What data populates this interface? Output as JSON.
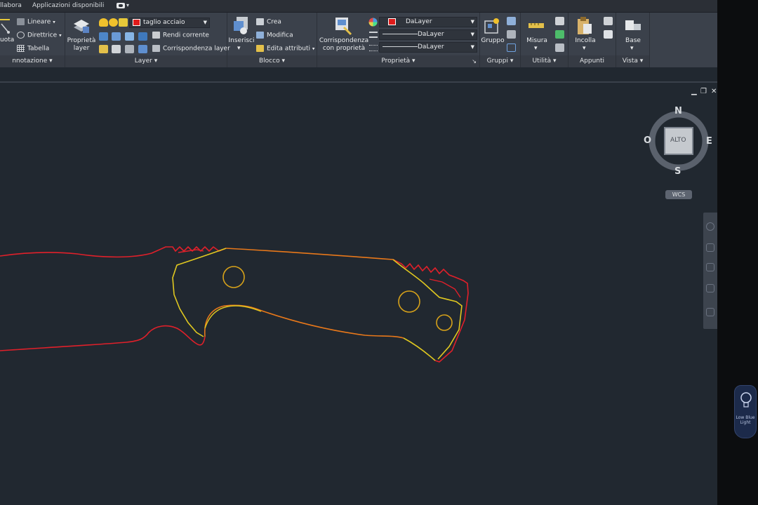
{
  "topbar": {
    "tabs": [
      "llabora",
      "Applicazioni disponibili"
    ]
  },
  "ribbon": {
    "annotazione": {
      "title": "nnotazione",
      "quota_label": "uota",
      "items": [
        "Lineare",
        "Direttrice",
        "Tabella"
      ]
    },
    "layer": {
      "title": "Layer",
      "proprieta_layer": "Proprietà\nlayer",
      "current_layer": "taglio acciaio",
      "items": [
        "Rendi corrente",
        "Corrispondenza layer"
      ]
    },
    "blocco": {
      "title": "Blocco",
      "inserisci": "Inserisci",
      "items": [
        "Crea",
        "Modifica",
        "Edita attributi"
      ]
    },
    "proprieta": {
      "title": "Proprietà",
      "corrispondenza": "Corrispondenza\ncon proprietà",
      "color_value": "DaLayer",
      "linetype_value": "DaLayer",
      "lineweight_value": "DaLayer"
    },
    "gruppi": {
      "title": "Gruppi",
      "gruppo": "Gruppo"
    },
    "utilita": {
      "title": "Utilità",
      "misura": "Misura"
    },
    "appunti": {
      "title": "Appunti",
      "incolla": "Incolla"
    },
    "vista": {
      "title": "Vista",
      "base": "Base"
    }
  },
  "viewcube": {
    "north": "N",
    "south": "S",
    "east": "E",
    "west": "O",
    "face": "ALTO",
    "wcs": "WCS"
  },
  "lowblue": {
    "label": "Low Blue Light"
  },
  "colors": {
    "canvas_bg": "#212830",
    "ribbon_bg": "#3b414b",
    "outline_red": "#e0202a",
    "outline_orange": "#e8781a",
    "outline_yellow": "#e0c820",
    "hole_color": "#d7a21a",
    "layer_swatch": "#e01b1b"
  }
}
